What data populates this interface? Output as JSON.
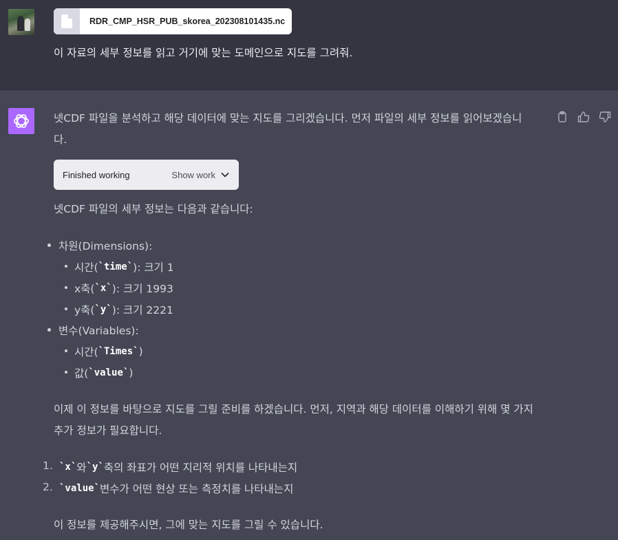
{
  "user": {
    "file_name": "RDR_CMP_HSR_PUB_skorea_202308101435.nc",
    "message": "이 자료의 세부 정보를 읽고 거기에 맞는 도메인으로 지도를 그려줘."
  },
  "assistant": {
    "intro_line1": "넷CDF 파일을 분석하고 해당 데이터에 맞는 지도를 그리겠습니다. 먼저 파일의 세부 정보를 읽어보겠습니",
    "intro_line2": "다.",
    "working_label": "Finished working",
    "show_work_label": "Show work",
    "details_heading": "넷CDF 파일의 세부 정보는 다음과 같습니다:",
    "dimensions_label": "차원(Dimensions):",
    "dimensions": [
      {
        "pre": "시간(",
        "code": "`time`",
        "post": "): 크기 1"
      },
      {
        "pre": "x축(",
        "code": "`x`",
        "post": "): 크기 1993"
      },
      {
        "pre": "y축(",
        "code": "`y`",
        "post": "): 크기 2221"
      }
    ],
    "variables_label": "변수(Variables):",
    "variables": [
      {
        "pre": "시간(",
        "code": "`Times`",
        "post": ")"
      },
      {
        "pre": "값(",
        "code": "`value`",
        "post": ")"
      }
    ],
    "prep_line1": "이제 이 정보를 바탕으로 지도를 그릴 준비를 하겠습니다. 먼저, 지역과 해당 데이터를 이해하기 위해 몇 가지",
    "prep_line2": "추가 정보가 필요합니다.",
    "questions": [
      {
        "num": "1.",
        "code_a": "`x`",
        "mid": "와 ",
        "code_b": "`y`",
        "post": " 축의 좌표가 어떤 지리적 위치를 나타내는지"
      },
      {
        "num": "2.",
        "code_a": "`value`",
        "mid": "",
        "code_b": "",
        "post": " 변수가 어떤 현상 또는 측정치를 나타내는지"
      }
    ],
    "closing": "이 정보를 제공해주시면, 그에 맞는 지도를 그릴 수 있습니다."
  },
  "icons": {
    "file": "file-icon",
    "assistant_avatar": "openai-logo-icon",
    "copy": "clipboard-icon",
    "like": "thumbs-up-icon",
    "dislike": "thumbs-down-icon",
    "chevron": "chevron-down-icon"
  },
  "colors": {
    "user_bg": "#343541",
    "assistant_bg": "#444654",
    "assistant_avatar": "#ab68ff"
  }
}
